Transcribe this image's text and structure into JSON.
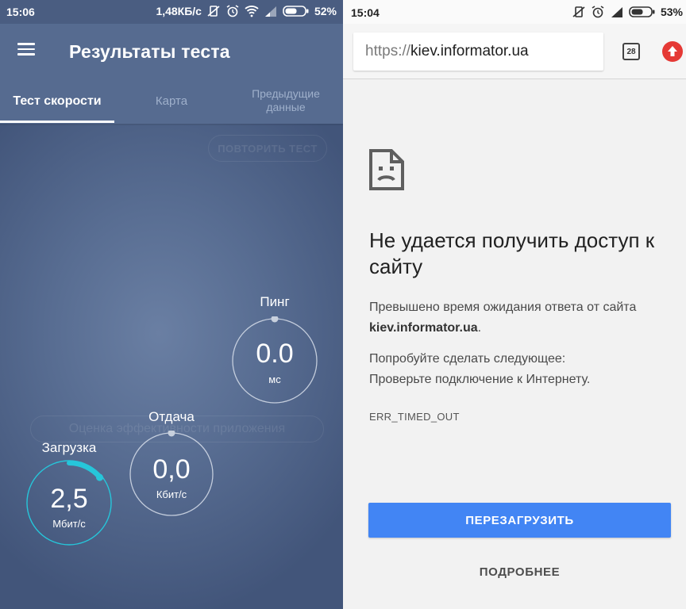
{
  "left_status": {
    "time": "15:06",
    "speed": "1,48КБ/с",
    "battery": "52%"
  },
  "speedtest": {
    "title": "Результаты теста",
    "tabs": [
      {
        "label": "Тест скорости"
      },
      {
        "label": "Карта"
      },
      {
        "label": "Предыдущие\nданные"
      }
    ],
    "ghost_retry": "ПОВТОРИТЬ ТЕСТ",
    "ghost_rate": "Оценка эффективности приложения",
    "ping": {
      "label": "Пинг",
      "value": "0.0",
      "unit": "мс"
    },
    "upload": {
      "label": "Отдача",
      "value": "0,0",
      "unit": "Кбит/с"
    },
    "download": {
      "label": "Загрузка",
      "value": "2,5",
      "unit": "Мбит/с",
      "progress": 0.14
    },
    "colors": {
      "accent": "#26c6da",
      "ring": "#d7deea"
    }
  },
  "right_status": {
    "time": "15:04",
    "battery": "53%"
  },
  "browser": {
    "url_scheme": "https://",
    "url_host": "kiev.informator.ua",
    "tab_count": "28",
    "error": {
      "title": "Не удается получить доступ к сайту",
      "timeout_text": "Превышено время ожидания ответа от сайта",
      "host": "kiev.informator.ua",
      "host_suffix": ".",
      "try_text": "Попробуйте сделать следующее:",
      "check_text": "Проверьте подключение к Интернету.",
      "code": "ERR_TIMED_OUT"
    },
    "reload_label": "ПЕРЕЗАГРУЗИТЬ",
    "details_label": "ПОДРОБНЕЕ",
    "colors": {
      "primary": "#4285f4",
      "update_badge": "#e53935"
    }
  }
}
